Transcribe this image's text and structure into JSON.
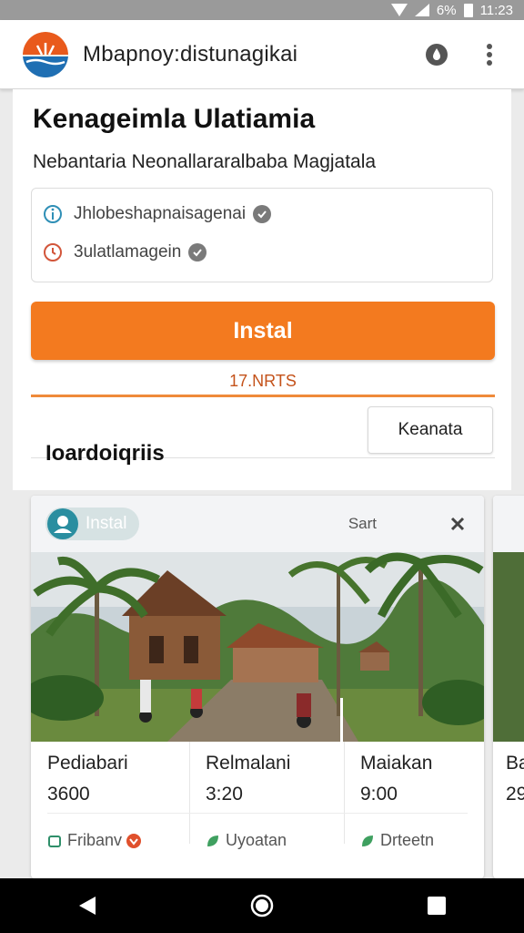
{
  "status_bar": {
    "battery_text": "6%",
    "time": "11:23"
  },
  "app_bar": {
    "title": "Mbapnoy:distunagikai",
    "brand_color": "#e95a1c"
  },
  "main": {
    "title": "Kenageimla Ulatiamia",
    "subtitle": "Nebantaria Neonallararalbaba Magjatala",
    "info_rows": [
      {
        "text": "Jhlobeshapnaisagenai",
        "icon": "info-icon"
      },
      {
        "text": "3ulatlamagein",
        "icon": "clock-icon"
      }
    ],
    "install_label": "Instal",
    "install_color": "#f37a1f",
    "size_text": "17.NRTS",
    "section_title": "Ioardoiqriis",
    "more_button_label": "Keanata"
  },
  "listing": {
    "chip_label": "Instal",
    "save_label": "Sart",
    "columns": [
      {
        "name": "Pediabari",
        "price": "3600",
        "tag": "Fribanv",
        "tag_icon": "calendar-icon"
      },
      {
        "name": "Relmalani",
        "price": "3:20",
        "tag": "Uyoatan",
        "tag_icon": "leaf-icon"
      },
      {
        "name": "Maiakan",
        "price": "9:00",
        "tag": "Drteetn",
        "tag_icon": "leaf-icon"
      }
    ],
    "peek": {
      "name": "Ba",
      "price": "29"
    }
  },
  "nav_bar": {
    "back_icon": "back-icon",
    "home_icon": "home-icon",
    "recents_icon": "recents-icon"
  }
}
